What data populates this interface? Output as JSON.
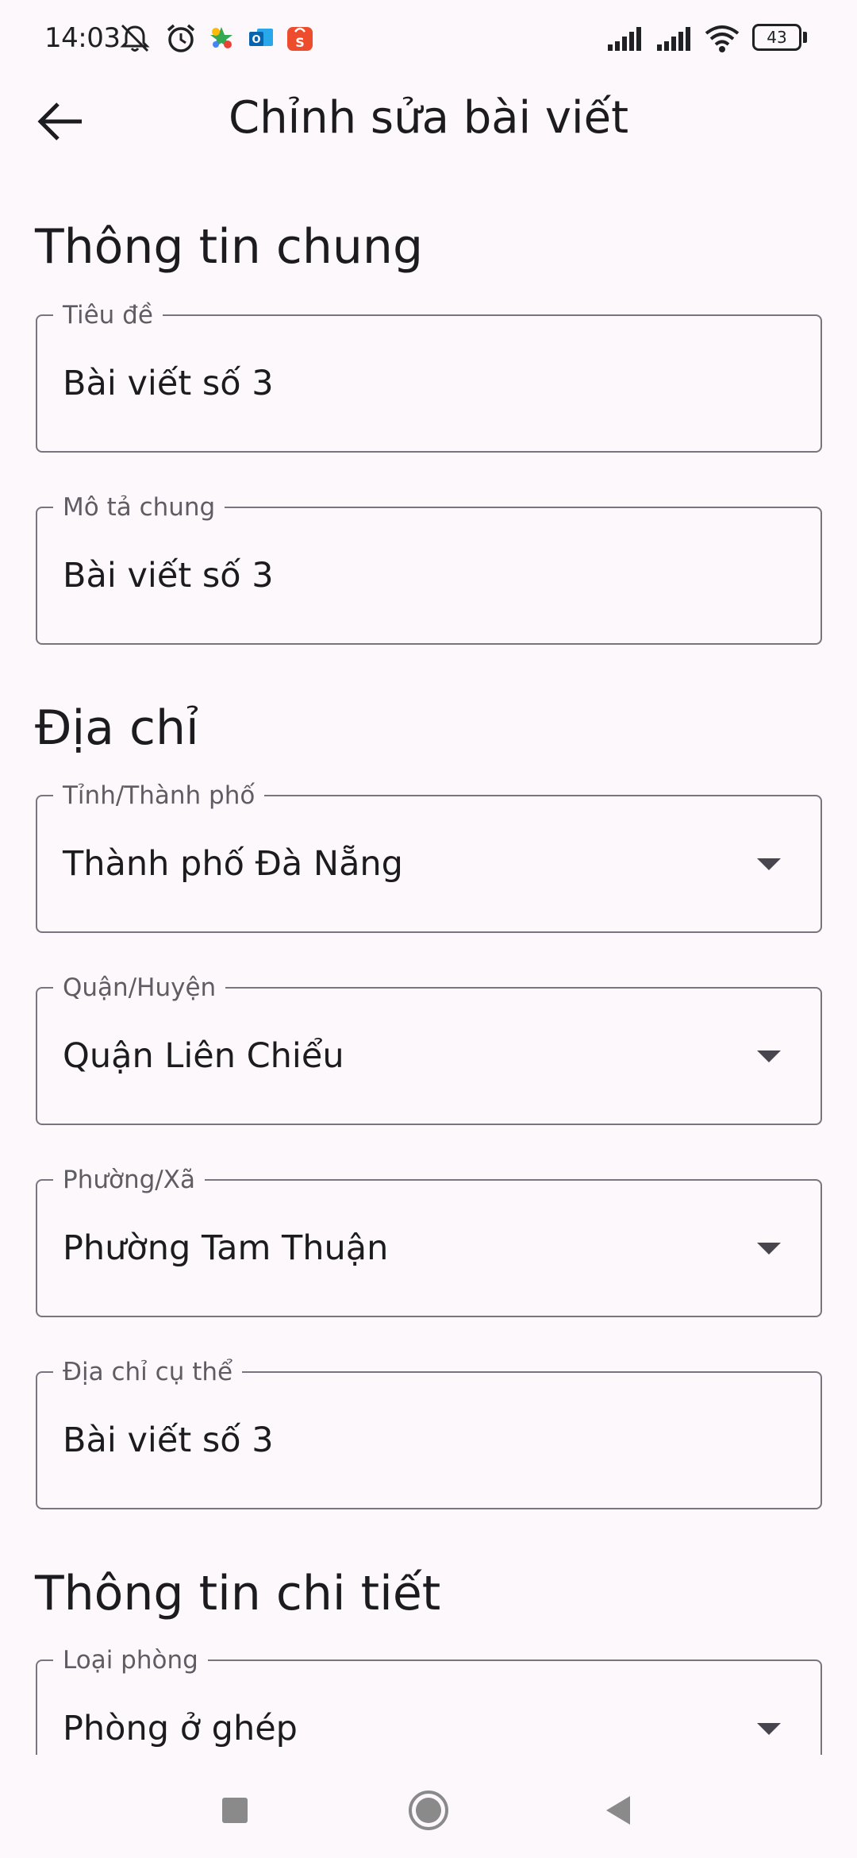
{
  "status_bar": {
    "time": "14:03",
    "battery": "43",
    "icons": [
      "mute-icon",
      "alarm-icon",
      "app-notification-icon",
      "outlook-icon",
      "shopee-icon",
      "signal-icon",
      "signal-icon",
      "wifi-icon",
      "battery-icon"
    ]
  },
  "app_bar": {
    "title": "Chỉnh sửa bài viết",
    "back_icon": "arrow-back-icon"
  },
  "sections": {
    "general": {
      "title": "Thông tin chung",
      "title_field": {
        "label": "Tiêu đề",
        "value": "Bài viết số 3"
      },
      "description_field": {
        "label": "Mô tả chung",
        "value": "Bài viết số 3"
      }
    },
    "address": {
      "title": "Địa chỉ",
      "province": {
        "label": "Tỉnh/Thành phố",
        "value": "Thành phố Đà Nẵng"
      },
      "district": {
        "label": "Quận/Huyện",
        "value": "Quận Liên Chiểu"
      },
      "ward": {
        "label": "Phường/Xã",
        "value": "Phường Tam Thuận"
      },
      "street": {
        "label": "Địa chỉ cụ thể",
        "value": "Bài viết số 3"
      }
    },
    "details": {
      "title": "Thông tin chi tiết",
      "room_type": {
        "label": "Loại phòng",
        "value": "Phòng ở ghép"
      }
    }
  },
  "nav_bar": {
    "icons": [
      "recents-icon",
      "home-icon",
      "back-icon"
    ]
  },
  "colors": {
    "background": "#fdf8fc",
    "outline": "#79747e",
    "text": "#1c1b1f",
    "label": "#5f5c63"
  }
}
